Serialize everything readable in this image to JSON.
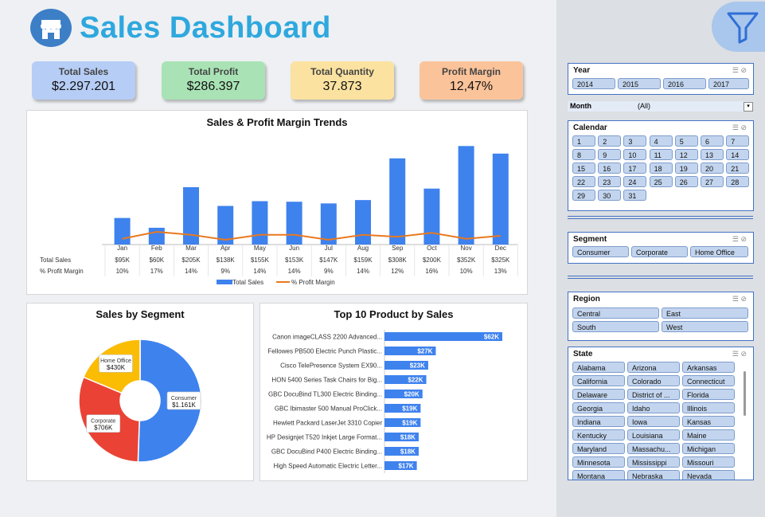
{
  "header": {
    "title": "Sales Dashboard"
  },
  "colors": {
    "blue": "#3e82ee",
    "orange": "#e8791f",
    "red": "#ea4335",
    "yellow": "#fbbc04",
    "title_blue": "#2ea8de"
  },
  "kpis": [
    {
      "label": "Total Sales",
      "value": "$2.297.201",
      "color": "#b6cdf5"
    },
    {
      "label": "Total Profit",
      "value": "$286.397",
      "color": "#a9e3b5"
    },
    {
      "label": "Total Quantity",
      "value": "37.873",
      "color": "#fbe2a0"
    },
    {
      "label": "Profit Margin",
      "value": "12,47%",
      "color": "#fbc39a"
    }
  ],
  "chart_data": [
    {
      "type": "bar",
      "title": "Sales & Profit Margin Trends",
      "categories": [
        "Jan",
        "Feb",
        "Mar",
        "Apr",
        "May",
        "Jun",
        "Jul",
        "Aug",
        "Sep",
        "Oct",
        "Nov",
        "Dec"
      ],
      "series": [
        {
          "name": "Total Sales",
          "values": [
            95,
            60,
            205,
            138,
            155,
            153,
            147,
            159,
            308,
            200,
            352,
            325
          ],
          "labels": [
            "$95K",
            "$60K",
            "$205K",
            "$138K",
            "$155K",
            "$153K",
            "$147K",
            "$159K",
            "$308K",
            "$200K",
            "$352K",
            "$325K"
          ]
        },
        {
          "name": "% Profit Margin",
          "values": [
            10,
            17,
            14,
            9,
            14,
            14,
            9,
            14,
            12,
            16,
            10,
            13
          ],
          "labels": [
            "10%",
            "17%",
            "14%",
            "9%",
            "14%",
            "14%",
            "9%",
            "14%",
            "12%",
            "16%",
            "10%",
            "13%"
          ]
        }
      ],
      "table_rows": [
        "Total Sales",
        "% Profit Margin"
      ],
      "legend": [
        "Total Sales",
        "% Profit Margin"
      ],
      "legend_position": "bottom"
    },
    {
      "type": "pie",
      "title": "Sales by Segment",
      "categories": [
        "Consumer",
        "Corporate",
        "Home Office"
      ],
      "values": [
        1161,
        706,
        430
      ],
      "labels": [
        "$1.161K",
        "$706K",
        "$430K"
      ]
    },
    {
      "type": "bar",
      "title": "Top 10 Product by Sales",
      "categories": [
        "Canon imageCLASS 2200 Advanced...",
        "Fellowes PB500 Electric Punch Plastic...",
        "Cisco TelePresence System EX90...",
        "HON 5400 Series Task Chairs for Big...",
        "GBC DocuBind TL300 Electric Binding...",
        "GBC Ibimaster 500 Manual ProClick...",
        "Hewlett Packard LaserJet 3310 Copier",
        "HP Designjet T520 Inkjet Large Format...",
        "GBC DocuBind P400 Electric Binding...",
        "High Speed Automatic Electric Letter..."
      ],
      "values": [
        62,
        27,
        23,
        22,
        20,
        19,
        19,
        18,
        18,
        17
      ],
      "labels": [
        "$62K",
        "$27K",
        "$23K",
        "$22K",
        "$20K",
        "$19K",
        "$19K",
        "$18K",
        "$18K",
        "$17K"
      ]
    }
  ],
  "slicers": {
    "year": {
      "title": "Year",
      "items": [
        "2014",
        "2015",
        "2016",
        "2017"
      ]
    },
    "month": {
      "label": "Month",
      "value": "(All)"
    },
    "calendar": {
      "title": "Calendar",
      "items": [
        "1",
        "2",
        "3",
        "4",
        "5",
        "6",
        "7",
        "8",
        "9",
        "10",
        "11",
        "12",
        "13",
        "14",
        "15",
        "16",
        "17",
        "18",
        "19",
        "20",
        "21",
        "22",
        "23",
        "24",
        "25",
        "26",
        "27",
        "28",
        "29",
        "30",
        "31"
      ]
    },
    "segment": {
      "title": "Segment",
      "items": [
        "Consumer",
        "Corporate",
        "Home Office"
      ]
    },
    "region": {
      "title": "Region",
      "items": [
        "Central",
        "East",
        "South",
        "West"
      ]
    },
    "state": {
      "title": "State",
      "items": [
        "Alabama",
        "Arizona",
        "Arkansas",
        "California",
        "Colorado",
        "Connecticut",
        "Delaware",
        "District of ...",
        "Florida",
        "Georgia",
        "Idaho",
        "Illinois",
        "Indiana",
        "Iowa",
        "Kansas",
        "Kentucky",
        "Louisiana",
        "Maine",
        "Maryland",
        "Massachu...",
        "Michigan",
        "Minnesota",
        "Mississippi",
        "Missouri",
        "Montana",
        "Nebraska",
        "Nevada"
      ]
    }
  }
}
